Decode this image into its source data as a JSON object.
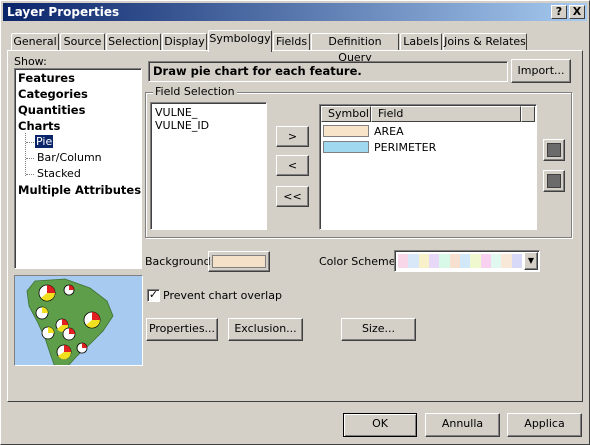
{
  "window": {
    "title": "Layer Properties",
    "help_btn": "?",
    "close_btn": "X"
  },
  "tabs": [
    {
      "label": "General"
    },
    {
      "label": "Source"
    },
    {
      "label": "Selection"
    },
    {
      "label": "Display"
    },
    {
      "label": "Symbology",
      "active": true
    },
    {
      "label": "Fields"
    },
    {
      "label": "Definition Query"
    },
    {
      "label": "Labels"
    },
    {
      "label": "Joins & Relates"
    }
  ],
  "show": {
    "label": "Show:",
    "items": [
      {
        "label": "Features"
      },
      {
        "label": "Categories"
      },
      {
        "label": "Quantities"
      },
      {
        "label": "Charts"
      },
      {
        "label": "Pie",
        "selected": true
      },
      {
        "label": "Bar/Column"
      },
      {
        "label": "Stacked"
      },
      {
        "label": "Multiple Attributes"
      }
    ]
  },
  "description": "Draw pie chart for each feature.",
  "import_label": "Import...",
  "field_selection": {
    "title": "Field Selection",
    "available": [
      "VULNE_",
      "VULNE_ID"
    ],
    "move_buttons": {
      "add": ">",
      "remove": "<",
      "remove_all": "<<"
    },
    "columns": {
      "symbol": "Symbol",
      "field": "Field"
    },
    "selected": [
      {
        "field": "AREA",
        "color": "#f8e4c8"
      },
      {
        "field": "PERIMETER",
        "color": "#a0d8f0"
      }
    ]
  },
  "background": {
    "label": "Background:",
    "color": "#f5e0c8"
  },
  "color_scheme": {
    "label": "Color  Scheme:",
    "colors": [
      "#f8d8e8",
      "#d8e8f8",
      "#f8f0c8",
      "#e8d8f8",
      "#d8f8e8",
      "#f8e0d0",
      "#d0e8f8",
      "#f0f8d0",
      "#f8d0f0",
      "#e0f8f0",
      "#f8e8d8",
      "#d8d8f8"
    ]
  },
  "prevent_overlap": {
    "label": "Prevent chart overlap",
    "checked": true,
    "mark": "✓"
  },
  "buttons": {
    "properties": "Properties...",
    "exclusion": "Exclusion...",
    "size": "Size...",
    "ok": "OK",
    "cancel": "Annulla",
    "apply": "Applica"
  }
}
